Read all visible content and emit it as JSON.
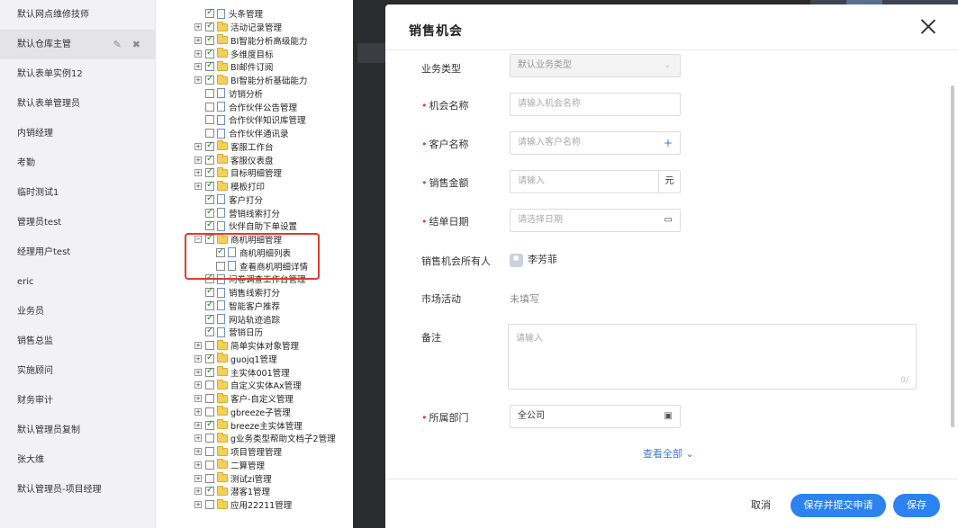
{
  "roles": [
    {
      "label": "默认网点维修技师"
    },
    {
      "label": "默认仓库主管",
      "active": true
    },
    {
      "label": "默认表单实例12"
    },
    {
      "label": "默认表单管理员"
    },
    {
      "label": "内销经理"
    },
    {
      "label": "考勤"
    },
    {
      "label": "临时测试1"
    },
    {
      "label": "管理员test"
    },
    {
      "label": "经理用户test"
    },
    {
      "label": "eric"
    },
    {
      "label": "业务员"
    },
    {
      "label": "销售总监"
    },
    {
      "label": "实施顾问"
    },
    {
      "label": "财务审计"
    },
    {
      "label": "默认管理员复制"
    },
    {
      "label": "张大维"
    },
    {
      "label": "默认管理员-项目经理"
    }
  ],
  "role_actions": {
    "edit_icon": "edit-icon",
    "delete_icon": "close-icon"
  },
  "tree": [
    {
      "label": "头条管理",
      "indent": 1,
      "exp": false,
      "checked": true,
      "icon": "file"
    },
    {
      "label": "活动记录管理",
      "indent": 0,
      "exp": true,
      "checked": true,
      "icon": "folder"
    },
    {
      "label": "BI智能分析高级能力",
      "indent": 0,
      "exp": true,
      "checked": true,
      "icon": "folder"
    },
    {
      "label": "多维度目标",
      "indent": 0,
      "exp": true,
      "checked": true,
      "icon": "folder"
    },
    {
      "label": "BI邮件订阅",
      "indent": 0,
      "exp": true,
      "checked": true,
      "icon": "folder"
    },
    {
      "label": "BI智能分析基础能力",
      "indent": 0,
      "exp": true,
      "checked": true,
      "icon": "folder"
    },
    {
      "label": "访销分析",
      "indent": 1,
      "exp": false,
      "checked": false,
      "icon": "file"
    },
    {
      "label": "合作伙伴公告管理",
      "indent": 1,
      "exp": false,
      "checked": false,
      "icon": "file"
    },
    {
      "label": "合作伙伴知识库管理",
      "indent": 1,
      "exp": false,
      "checked": false,
      "icon": "file"
    },
    {
      "label": "合作伙伴通讯录",
      "indent": 1,
      "exp": false,
      "checked": false,
      "icon": "file"
    },
    {
      "label": "客服工作台",
      "indent": 0,
      "exp": true,
      "checked": true,
      "icon": "folder"
    },
    {
      "label": "客服仪表盘",
      "indent": 0,
      "exp": true,
      "checked": true,
      "icon": "folder"
    },
    {
      "label": "目标明细管理",
      "indent": 0,
      "exp": true,
      "checked": true,
      "icon": "folder"
    },
    {
      "label": "模板打印",
      "indent": 0,
      "exp": true,
      "checked": true,
      "icon": "folder"
    },
    {
      "label": "客户打分",
      "indent": 1,
      "exp": false,
      "checked": true,
      "icon": "file"
    },
    {
      "label": "营销线索打分",
      "indent": 1,
      "exp": false,
      "checked": true,
      "icon": "file"
    },
    {
      "label": "伙伴自助下单设置",
      "indent": 1,
      "exp": false,
      "checked": true,
      "icon": "file"
    },
    {
      "label": "商机明细管理",
      "indent": 0,
      "exp": true,
      "expanded": true,
      "checked": true,
      "icon": "folder"
    },
    {
      "label": "商机明细列表",
      "indent": 2,
      "exp": false,
      "checked": true,
      "icon": "file"
    },
    {
      "label": "查看商机明细详情",
      "indent": 2,
      "exp": false,
      "checked": false,
      "icon": "file"
    },
    {
      "label": "问卷调查工作台管理",
      "indent": 1,
      "exp": false,
      "checked": true,
      "icon": "file"
    },
    {
      "label": "销售线索打分",
      "indent": 1,
      "exp": false,
      "checked": true,
      "icon": "file"
    },
    {
      "label": "智能客户推荐",
      "indent": 1,
      "exp": false,
      "checked": true,
      "icon": "file"
    },
    {
      "label": "网站轨迹追踪",
      "indent": 1,
      "exp": false,
      "checked": true,
      "icon": "file"
    },
    {
      "label": "营销日历",
      "indent": 1,
      "exp": false,
      "checked": true,
      "icon": "file"
    },
    {
      "label": "简单实体对象管理",
      "indent": 0,
      "exp": true,
      "checked": false,
      "icon": "folder"
    },
    {
      "label": "guojq1管理",
      "indent": 0,
      "exp": true,
      "checked": true,
      "icon": "folder"
    },
    {
      "label": "主实体001管理",
      "indent": 0,
      "exp": true,
      "checked": true,
      "icon": "folder"
    },
    {
      "label": "自定义实体Ax管理",
      "indent": 0,
      "exp": true,
      "checked": false,
      "icon": "folder"
    },
    {
      "label": "客户-自定义管理",
      "indent": 0,
      "exp": true,
      "checked": false,
      "icon": "folder"
    },
    {
      "label": "gbreeze子管理",
      "indent": 0,
      "exp": true,
      "checked": false,
      "icon": "folder"
    },
    {
      "label": "breeze主实体管理",
      "indent": 0,
      "exp": true,
      "checked": true,
      "icon": "folder"
    },
    {
      "label": "g业务类型帮助文档子2管理",
      "indent": 0,
      "exp": true,
      "checked": false,
      "icon": "folder"
    },
    {
      "label": "项目管理管理",
      "indent": 0,
      "exp": true,
      "checked": false,
      "icon": "folder"
    },
    {
      "label": "二算管理",
      "indent": 0,
      "exp": true,
      "checked": false,
      "icon": "folder"
    },
    {
      "label": "测试zi管理",
      "indent": 0,
      "exp": true,
      "checked": false,
      "icon": "folder"
    },
    {
      "label": "潜客1管理",
      "indent": 0,
      "exp": true,
      "checked": true,
      "icon": "folder"
    },
    {
      "label": "应用22211管理",
      "indent": 0,
      "exp": true,
      "checked": false,
      "icon": "folder"
    }
  ],
  "modal": {
    "title": "销售机会",
    "fields": {
      "biz_type": {
        "label": "业务类型",
        "value": "默认业务类型"
      },
      "opp_name": {
        "label": "机会名称",
        "placeholder": "请输入机会名称"
      },
      "customer": {
        "label": "客户名称",
        "placeholder": "请输入客户名称"
      },
      "amount": {
        "label": "销售金额",
        "placeholder": "请输入",
        "unit": "元"
      },
      "close_date": {
        "label": "结单日期",
        "placeholder": "请选择日期"
      },
      "owner": {
        "label": "销售机会所有人",
        "value": "李芳菲"
      },
      "campaign": {
        "label": "市场活动",
        "value": "未填写"
      },
      "remark": {
        "label": "备注",
        "placeholder": "请输入",
        "count": "0/"
      },
      "dept": {
        "label": "所属部门",
        "value": "全公司"
      }
    },
    "view_all": "查看全部",
    "buttons": {
      "cancel": "取消",
      "submit": "保存并提交申请",
      "save": "保存"
    }
  },
  "colors": {
    "primary": "#2b82f0",
    "required": "#e4393c",
    "highlight": "#e23b2e",
    "check": "#1a8f1a"
  }
}
